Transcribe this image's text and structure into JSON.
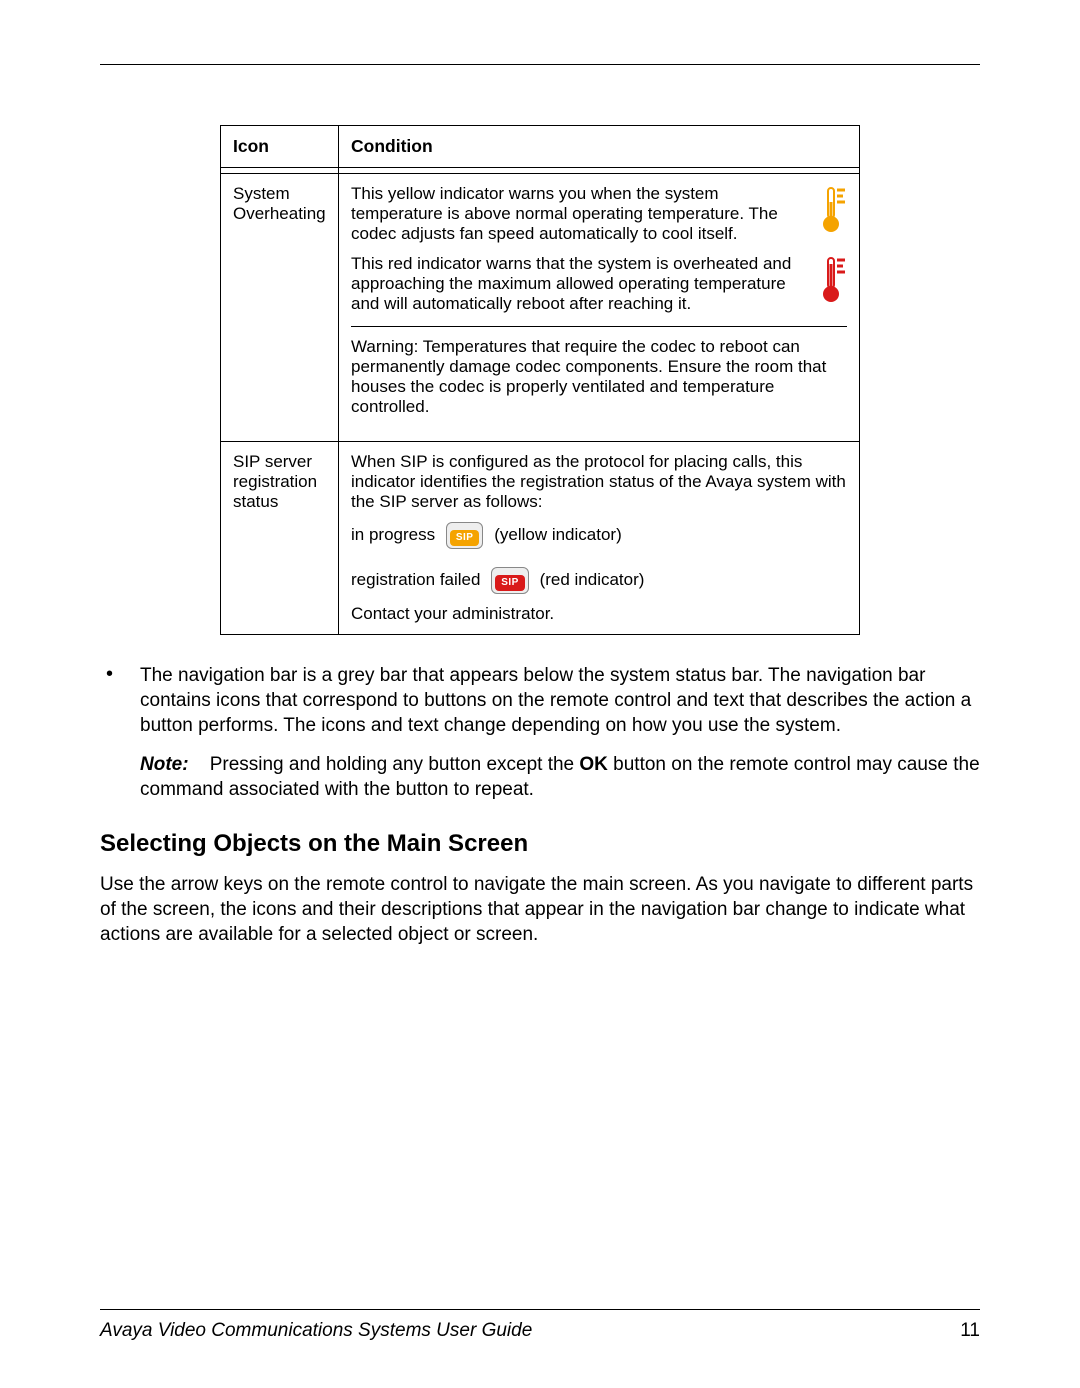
{
  "table": {
    "headers": {
      "icon": "Icon",
      "condition": "Condition"
    },
    "rows": [
      {
        "icon_label": "System Overheating",
        "para1": "This yellow indicator warns you when the system temperature is above normal operating temperature. The codec adjusts fan speed automatically to cool itself.",
        "para2": "This red indicator warns that the system is overheated and approaching the maximum allowed operating temperature and will automatically reboot after reaching it.",
        "warning": "Warning: Temperatures that require the codec to reboot can permanently damage codec components. Ensure the room that houses the codec is properly ventilated and temperature controlled."
      },
      {
        "icon_label": "SIP server registration status",
        "intro": "When SIP is configured as the protocol for placing calls, this indicator identifies the registration status of the Avaya system with the SIP server as follows:",
        "inprogress_prefix": "in progress",
        "inprogress_suffix": "(yellow indicator)",
        "failed_prefix": "registration failed",
        "failed_suffix": "(red indicator)",
        "contact": "Contact your administrator.",
        "sip_text": "SIP"
      }
    ]
  },
  "bullet": {
    "text": "The navigation bar is a grey bar that appears below the system status bar. The navigation bar contains icons that correspond to buttons on the remote control and text that describes the action a button performs. The icons and text change depending on how you use the system."
  },
  "note": {
    "label": "Note:",
    "before_ok": "Pressing and holding any button except the ",
    "ok": "OK",
    "after_ok": " button on the remote control may cause the command associated with the button to repeat."
  },
  "section": {
    "heading": "Selecting Objects on the Main Screen",
    "body": "Use the arrow keys on the remote control to navigate the main screen. As you navigate to different parts of the screen, the icons and their descriptions that appear in the navigation bar change to indicate what actions are available for a selected object or screen."
  },
  "footer": {
    "title": "Avaya Video Communications Systems User Guide",
    "page": "11"
  },
  "icons": {
    "thermo_yellow": "thermometer-yellow-icon",
    "thermo_red": "thermometer-red-icon"
  }
}
